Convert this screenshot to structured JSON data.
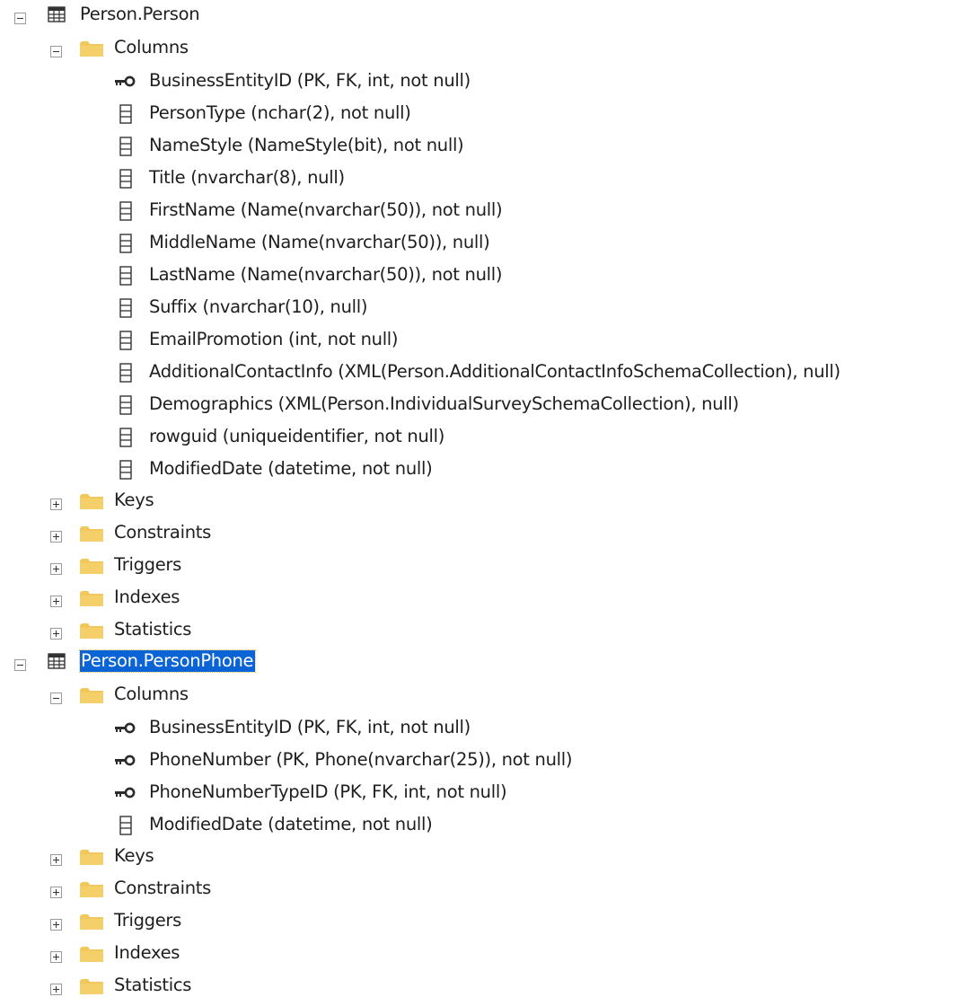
{
  "tables": [
    {
      "name": "Person.Person",
      "selected": false,
      "expanded": true,
      "columns_folder_label": "Columns",
      "columns": [
        {
          "key": true,
          "label": "BusinessEntityID (PK, FK, int, not null)"
        },
        {
          "key": false,
          "label": "PersonType (nchar(2), not null)"
        },
        {
          "key": false,
          "label": "NameStyle (NameStyle(bit), not null)"
        },
        {
          "key": false,
          "label": "Title (nvarchar(8), null)"
        },
        {
          "key": false,
          "label": "FirstName (Name(nvarchar(50)), not null)"
        },
        {
          "key": false,
          "label": "MiddleName (Name(nvarchar(50)), null)"
        },
        {
          "key": false,
          "label": "LastName (Name(nvarchar(50)), not null)"
        },
        {
          "key": false,
          "label": "Suffix (nvarchar(10), null)"
        },
        {
          "key": false,
          "label": "EmailPromotion (int, not null)"
        },
        {
          "key": false,
          "label": "AdditionalContactInfo (XML(Person.AdditionalContactInfoSchemaCollection), null)"
        },
        {
          "key": false,
          "label": "Demographics (XML(Person.IndividualSurveySchemaCollection), null)"
        },
        {
          "key": false,
          "label": "rowguid (uniqueidentifier, not null)"
        },
        {
          "key": false,
          "label": "ModifiedDate (datetime, not null)"
        }
      ],
      "folders": [
        "Keys",
        "Constraints",
        "Triggers",
        "Indexes",
        "Statistics"
      ]
    },
    {
      "name": "Person.PersonPhone",
      "selected": true,
      "expanded": true,
      "columns_folder_label": "Columns",
      "columns": [
        {
          "key": true,
          "label": "BusinessEntityID (PK, FK, int, not null)"
        },
        {
          "key": true,
          "label": "PhoneNumber (PK, Phone(nvarchar(25)), not null)"
        },
        {
          "key": true,
          "label": "PhoneNumberTypeID (PK, FK, int, not null)"
        },
        {
          "key": false,
          "label": "ModifiedDate (datetime, not null)"
        }
      ],
      "folders": [
        "Keys",
        "Constraints",
        "Triggers",
        "Indexes",
        "Statistics"
      ]
    }
  ],
  "icons": {
    "table": "table-grid-icon",
    "folder": "folder-icon",
    "key_column": "primary-key-icon",
    "column": "column-icon",
    "expanded": "minus-box-icon",
    "collapsed": "plus-box-icon"
  },
  "colors": {
    "selection_bg": "#0a64d6",
    "selection_text": "#ffffff",
    "folder": "#f2c75c",
    "text": "#1e1e1e"
  }
}
